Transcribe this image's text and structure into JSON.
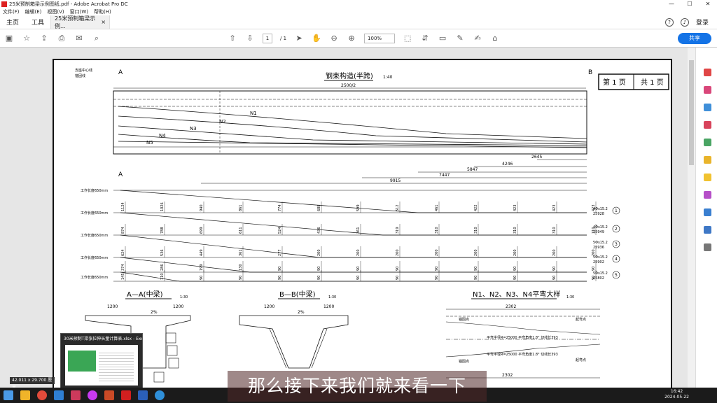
{
  "window": {
    "title": "25米预制箱梁示例图纸.pdf - Adobe Acrobat Pro DC",
    "controls": [
      "—",
      "☐",
      "✕"
    ]
  },
  "menu": [
    "文件(F)",
    "编辑(E)",
    "视图(V)",
    "窗口(W)",
    "帮助(H)"
  ],
  "tabs": {
    "home": "主页",
    "tools": "工具",
    "doc": "25米预制箱梁示例...",
    "doc_close": "×",
    "help": "?",
    "login": "登录"
  },
  "toolbar": {
    "page_current": "1",
    "page_total": "/ 1",
    "zoom": "100%",
    "share_label": "共享"
  },
  "drawing": {
    "title": "钢束构造(半跨)",
    "title_scale": "1:40",
    "page_label": "第 1 页",
    "total_label": "共 1 页",
    "half_span": "2500/2",
    "section_aa": "A—A(中梁)",
    "section_aa_scale": "1:30",
    "section_bb": "B—B(中梁)",
    "section_bb_scale": "1:30",
    "detail_title": "N1、N2、N3、N4平弯大样",
    "detail_scale": "1:30",
    "bearing_center": "支座中心线",
    "anchor_line": "锚固线",
    "tendons": [
      "N1",
      "N2",
      "N3",
      "N4",
      "N5"
    ],
    "dims": [
      "2645",
      "4246",
      "5847",
      "7447",
      "9915"
    ],
    "row_labels": [
      "工作长度650mm",
      "工作长度650mm",
      "工作长度650mm",
      "工作长度650mm",
      "工作长度650mm"
    ],
    "tendon_specs": [
      "4Φs15.2",
      "4Φs15.2",
      "5Φs15.2",
      "5Φs15.2",
      "5Φs15.2"
    ],
    "tendon_lengths": [
      "25928",
      "25949",
      "25936",
      "25902",
      "25802"
    ],
    "circle_nums": [
      "1",
      "2",
      "3",
      "4",
      "5"
    ],
    "row1_vals": [
      "1124",
      "1026",
      "940",
      "861",
      "774",
      "688",
      "599",
      "512",
      "461",
      "422",
      "423",
      "423",
      "423"
    ],
    "row2_vals": [
      "874",
      "788",
      "699",
      "611",
      "524",
      "436",
      "361",
      "319",
      "310",
      "310",
      "310",
      "310",
      "310"
    ],
    "row3_vals": [
      "624",
      "536",
      "449",
      "361",
      "277",
      "200",
      "200",
      "200",
      "200",
      "200",
      "200",
      "200",
      "200"
    ],
    "row4_vals": [
      "374",
      "286",
      "199",
      "130",
      "90",
      "90",
      "90",
      "90",
      "90",
      "90",
      "90",
      "90",
      "90"
    ],
    "row5_vals": [
      "145",
      "110",
      "90",
      "90",
      "90",
      "90",
      "90",
      "90",
      "90",
      "90",
      "90",
      "90",
      "90"
    ],
    "width_1200": "1200",
    "detail_2302": "2302",
    "detail_r1": "平弯半径R=25000  平弯角度1.8°  切线长393",
    "detail_r2": "平弯半径R=25000  平弯角度1.8°  切线长393",
    "anchor": "锚固点",
    "bend_point": "起弯点",
    "slope": "2%"
  },
  "preview": {
    "title": "30米预制T梁张拉伸长量计算表.xlsx - Excel"
  },
  "status": {
    "size": "42.011 x 29.700 厘米"
  },
  "clock": {
    "time": "16:42",
    "date": "2024-05-22"
  },
  "subtitle": "那么接下来我们就来看一下",
  "colors": {
    "accent": "#1473e6",
    "taskbar": "#1b1b1b"
  }
}
